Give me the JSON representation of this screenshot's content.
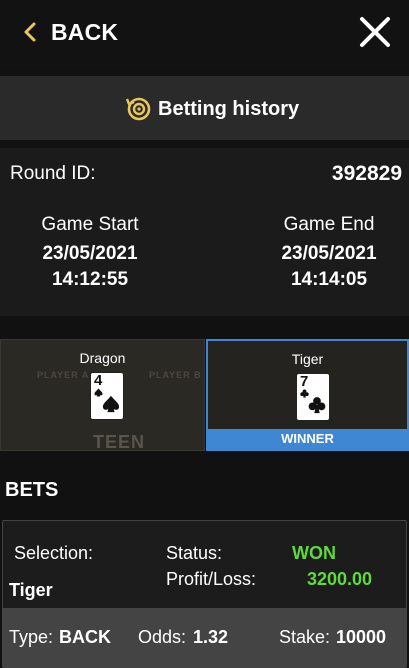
{
  "header": {
    "back_label": "BACK"
  },
  "history": {
    "label": "Betting history"
  },
  "round": {
    "id_label": "Round ID:",
    "id_value": "392829",
    "start_label": "Game Start",
    "start_date": "23/05/2021",
    "start_time": "14:12:55",
    "end_label": "Game End",
    "end_date": "23/05/2021",
    "end_time": "14:14:05"
  },
  "players": {
    "dragon": {
      "name": "Dragon",
      "card_rank": "4",
      "card_suit": "spade-icon"
    },
    "tiger": {
      "name": "Tiger",
      "card_rank": "7",
      "card_suit": "club-icon",
      "winner_label": "WINNER"
    },
    "felt": {
      "player_a": "PLAYER A",
      "player_b": "PLAYER B",
      "logo": "TEEN PATTI"
    }
  },
  "bets": {
    "title": "BETS",
    "selection_label": "Selection:",
    "selection_value": "Tiger",
    "status_label": "Status:",
    "status_value": "WON",
    "profit_label": "Profit/Loss:",
    "profit_value": "3200.00",
    "type_label": "Type:",
    "type_value": "BACK",
    "odds_label": "Odds:",
    "odds_value": "1.32",
    "stake_label": "Stake:",
    "stake_value": "10000"
  },
  "colors": {
    "accent_gold": "#e8c85a",
    "win_green": "#5fd93b",
    "winner_blue": "#3f86d3"
  }
}
